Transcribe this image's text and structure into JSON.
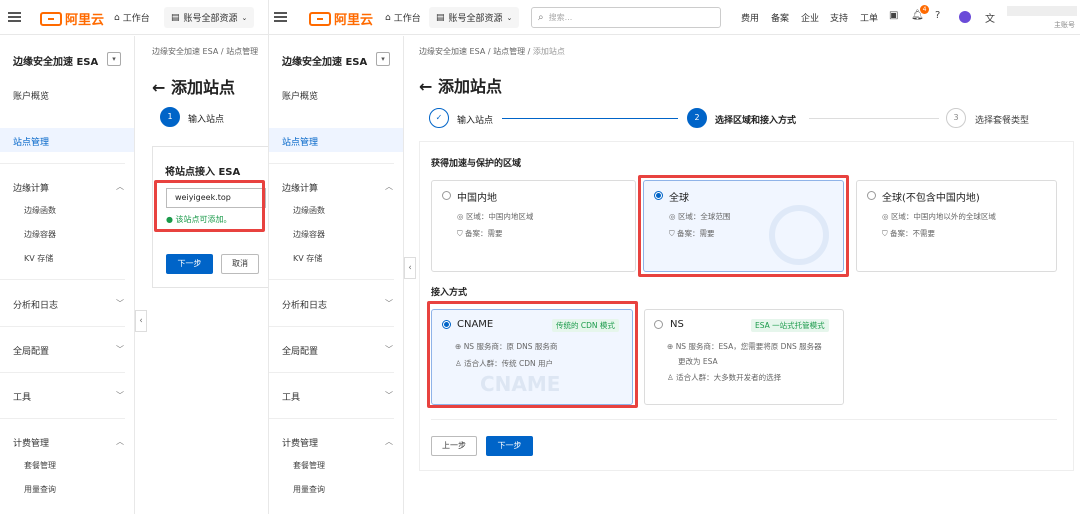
{
  "topbar": {
    "workbench": "工作台",
    "resource_group": "账号全部资源",
    "search_placeholder": "搜索...",
    "links": [
      "费用",
      "备案",
      "企业",
      "支持",
      "工单"
    ],
    "notification_count": "4",
    "account_label": "主账号"
  },
  "logo_text": "阿里云",
  "sidebar": {
    "title": "边缘安全加速 ESA",
    "overview": "账户概览",
    "site_mgmt": "站点管理",
    "edge_compute": "边缘计算",
    "edge_function": "边缘函数",
    "edge_container": "边缘容器",
    "kv_storage": "KV 存储",
    "analytics": "分析和日志",
    "global_config": "全局配置",
    "tools": "工具",
    "billing": "计费管理",
    "plan_mgmt": "套餐管理",
    "usage_query": "用量查询"
  },
  "left_panel": {
    "breadcrumb": [
      "边缘安全加速 ESA",
      "站点管理"
    ],
    "title": "添加站点",
    "step1_num": "1",
    "step1_label": "输入站点",
    "form_title": "将站点接入 ESA",
    "domain_value": "weiyigeek.top",
    "valid_msg": "该站点可添加。",
    "next_btn": "下一步",
    "cancel_btn": "取消"
  },
  "right_panel": {
    "breadcrumb": [
      "边缘安全加速 ESA",
      "站点管理",
      "添加站点"
    ],
    "title": "添加站点",
    "steps": [
      {
        "num": "✓",
        "label": "输入站点"
      },
      {
        "num": "2",
        "label": "选择区域和接入方式"
      },
      {
        "num": "3",
        "label": "选择套餐类型"
      }
    ],
    "region_section": "获得加速与保护的区域",
    "regions": [
      {
        "name": "中国内地",
        "area": "区域：中国内地区域",
        "icp": "备案：需要"
      },
      {
        "name": "全球",
        "area": "区域：全球范围",
        "icp": "备案：需要"
      },
      {
        "name": "全球(不包含中国内地)",
        "area": "区域：中国内地以外的全球区域",
        "icp": "备案：不需要"
      }
    ],
    "access_section": "接入方式",
    "access": [
      {
        "name": "CNAME",
        "tag": "传统的 CDN 模式",
        "line1": "NS 服务商：原 DNS 服务商",
        "line2": "适合人群：传统 CDN 用户",
        "watermark": "CNAME"
      },
      {
        "name": "NS",
        "tag": "ESA 一站式托管模式",
        "line1": "NS 服务商：ESA，您需要将原 DNS 服务器",
        "line1b": "更改为 ESA",
        "line2": "适合人群：大多数开发者的选择"
      }
    ],
    "prev_btn": "上一步",
    "next_btn": "下一步"
  },
  "colors": {
    "brand": "#ff6a00",
    "primary": "#0064c8",
    "highlight": "#e8423f",
    "success": "#1a9a4a"
  }
}
